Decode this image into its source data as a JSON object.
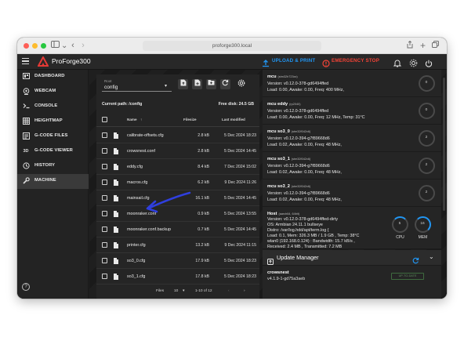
{
  "browser": {
    "url": "proforge300.local"
  },
  "app": {
    "brand": "ProForge300",
    "upload_label": "UPLOAD & PRINT",
    "estop_label": "EMERGENCY STOP",
    "accent": "#2196f3",
    "danger": "#f44336"
  },
  "sidebar": {
    "items": [
      {
        "label": "DASHBOARD",
        "icon": "dashboard-icon"
      },
      {
        "label": "WEBCAM",
        "icon": "webcam-icon"
      },
      {
        "label": "CONSOLE",
        "icon": "console-icon"
      },
      {
        "label": "HEIGHTMAP",
        "icon": "grid-icon"
      },
      {
        "label": "G-CODE FILES",
        "icon": "file-icon"
      },
      {
        "label": "G-CODE VIEWER",
        "icon": "3d-icon",
        "glyph": "3D"
      },
      {
        "label": "HISTORY",
        "icon": "history-icon"
      },
      {
        "label": "MACHINE",
        "icon": "wrench-icon",
        "active": true
      }
    ],
    "help_glyph": "?"
  },
  "files": {
    "root_label": "Root",
    "root_value": "config",
    "current_path_label": "Current path: /config",
    "free_disk_label": "Free disk: 24.5 GB",
    "columns": {
      "name": "Name",
      "size": "Filesize",
      "modified": "Last modified"
    },
    "rows": [
      {
        "name": "calibrate-offsets.cfg",
        "size": "2.8 kB",
        "modified": "5 Dec 2024 18:23"
      },
      {
        "name": "crowsnest.conf",
        "size": "2.8 kB",
        "modified": "5 Dec 2024 14:45"
      },
      {
        "name": "eddy.cfg",
        "size": "8.4 kB",
        "modified": "7 Dec 2024 15:02"
      },
      {
        "name": "macros.cfg",
        "size": "6.2 kB",
        "modified": "9 Dec 2024 11:26"
      },
      {
        "name": "mainsail.cfg",
        "size": "16.1 kB",
        "modified": "5 Dec 2024 14:45"
      },
      {
        "name": "moonraker.conf",
        "size": "0.9 kB",
        "modified": "5 Dec 2024 13:55"
      },
      {
        "name": "moonraker.conf.backup",
        "size": "0.7 kB",
        "modified": "5 Dec 2024 14:45"
      },
      {
        "name": "printer.cfg",
        "size": "13.2 kB",
        "modified": "9 Dec 2024 11:15"
      },
      {
        "name": "so3_0.cfg",
        "size": "17.9 kB",
        "modified": "5 Dec 2024 18:23"
      },
      {
        "name": "so3_1.cfg",
        "size": "17.8 kB",
        "modified": "5 Dec 2024 18:23"
      }
    ],
    "footer": {
      "files_label": "Files",
      "per_page": "10",
      "range": "1-10 of 12"
    }
  },
  "mcus": [
    {
      "name": "mcu",
      "chip": "(stm32h723xx)",
      "version": "Version: v0.12.0-378-gd6494ffed",
      "load": "Load: 0.00, Awake: 0.00, Freq: 400 MHz,",
      "gauge": "0"
    },
    {
      "name": "mcu eddy",
      "chip": "(rp2040)",
      "version": "Version: v0.12.0-378-gd6494ffed",
      "load": "Load: 0.00, Awake: 0.00, Freq: 12 MHz, Temp: 31°C",
      "gauge": "0"
    },
    {
      "name": "mcu so3_0",
      "chip": "(stm32f042x6)",
      "version": "Version: v0.12.0-394-g7f89668d6",
      "load": "Load: 0.02, Awake: 0.00, Freq: 48 MHz,",
      "gauge": "2"
    },
    {
      "name": "mcu so3_1",
      "chip": "(stm32f042x6)",
      "version": "Version: v0.12.0-394-g7f89668d6",
      "load": "Load: 0.02, Awake: 0.00, Freq: 48 MHz,",
      "gauge": "2"
    },
    {
      "name": "mcu so3_2",
      "chip": "(stm32f042x6)",
      "version": "Version: v0.12.0-394-g7f89668d6",
      "load": "Load: 0.02, Awake: 0.00, Freq: 48 MHz,",
      "gauge": "2"
    }
  ],
  "host": {
    "name": "Host",
    "arch": "(aarch64, 64bit)",
    "lines": [
      "Version: v0.12.0-378-gd6494ffed-dirty",
      "OS: Armbian 24.11.1 bullseye",
      "Distro: /var/log.hdd/apt/term.log {",
      "Load: 0.1, Mem: 326.3 MB / 1.9 GB , Temp: 38°C",
      "wlan0 (192.168.0.124) : Bandwidth: 15.7 kB/s ,",
      "Received: 2.4 MB , Transmitted: 7.2 MB"
    ],
    "cpu": {
      "label": "CPU",
      "value": "5"
    },
    "mem": {
      "label": "MEM",
      "value": "16"
    }
  },
  "update_manager": {
    "title": "Update Manager",
    "items": [
      {
        "name": "crowsnest",
        "version": "v4.1.9-1-gd75a3aeb",
        "status": "UP-TO-DATE"
      }
    ]
  }
}
